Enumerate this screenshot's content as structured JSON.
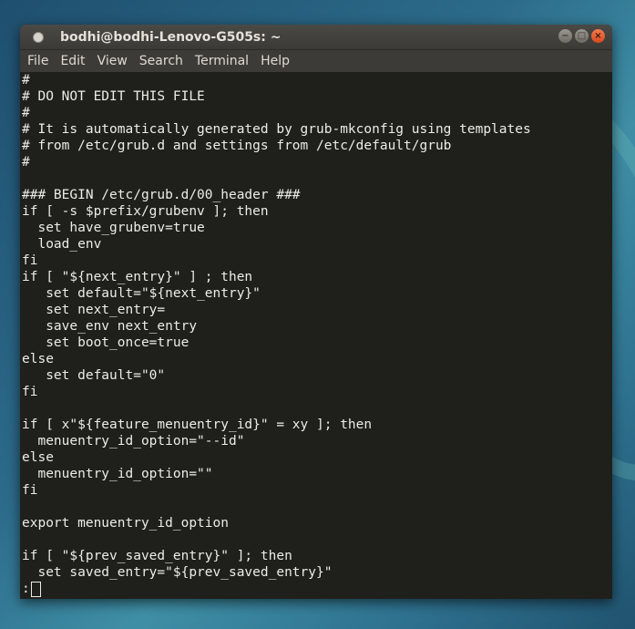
{
  "window": {
    "title": "bodhi@bodhi-Lenovo-G505s: ~",
    "buttons": {
      "minimize": "−",
      "maximize": "□",
      "close": "×"
    }
  },
  "menu": [
    "File",
    "Edit",
    "View",
    "Search",
    "Terminal",
    "Help"
  ],
  "terminal": {
    "lines": [
      "#",
      "# DO NOT EDIT THIS FILE",
      "#",
      "# It is automatically generated by grub-mkconfig using templates",
      "# from /etc/grub.d and settings from /etc/default/grub",
      "#",
      "",
      "### BEGIN /etc/grub.d/00_header ###",
      "if [ -s $prefix/grubenv ]; then",
      "  set have_grubenv=true",
      "  load_env",
      "fi",
      "if [ \"${next_entry}\" ] ; then",
      "   set default=\"${next_entry}\"",
      "   set next_entry=",
      "   save_env next_entry",
      "   set boot_once=true",
      "else",
      "   set default=\"0\"",
      "fi",
      "",
      "if [ x\"${feature_menuentry_id}\" = xy ]; then",
      "  menuentry_id_option=\"--id\"",
      "else",
      "  menuentry_id_option=\"\"",
      "fi",
      "",
      "export menuentry_id_option",
      "",
      "if [ \"${prev_saved_entry}\" ]; then",
      "  set saved_entry=\"${prev_saved_entry}\""
    ],
    "prompt": ":"
  }
}
